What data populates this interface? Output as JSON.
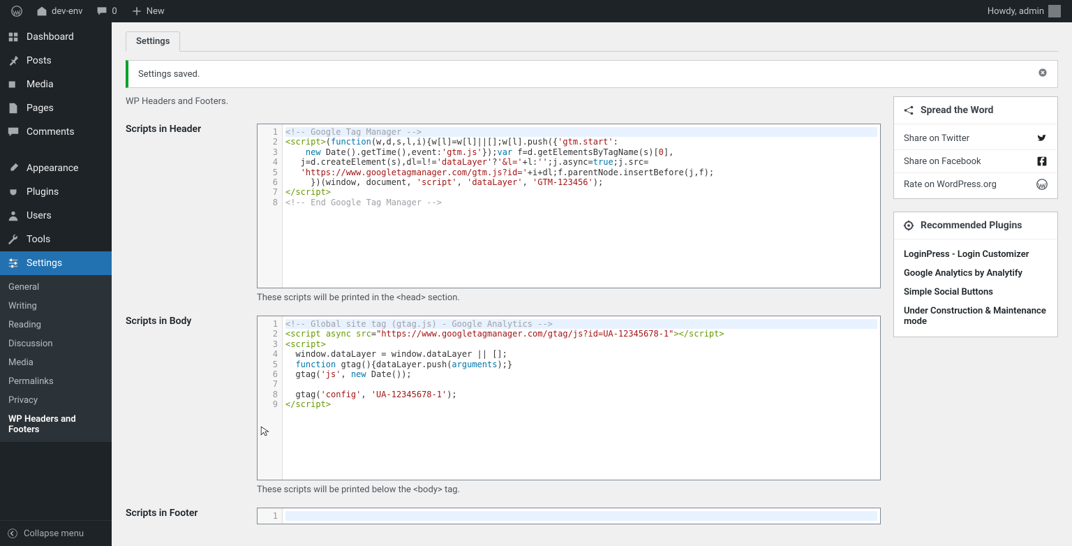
{
  "adminbar": {
    "site": "dev-env",
    "comments": "0",
    "new": "New",
    "howdy": "Howdy, admin"
  },
  "sidebar": {
    "items": [
      {
        "icon": "dashboard",
        "label": "Dashboard"
      },
      {
        "icon": "pin",
        "label": "Posts"
      },
      {
        "icon": "media",
        "label": "Media"
      },
      {
        "icon": "page",
        "label": "Pages"
      },
      {
        "icon": "comment",
        "label": "Comments"
      },
      {
        "icon": "brush",
        "label": "Appearance"
      },
      {
        "icon": "plug",
        "label": "Plugins"
      },
      {
        "icon": "user",
        "label": "Users"
      },
      {
        "icon": "wrench",
        "label": "Tools"
      },
      {
        "icon": "sliders",
        "label": "Settings"
      }
    ],
    "sub": [
      "General",
      "Writing",
      "Reading",
      "Discussion",
      "Media",
      "Permalinks",
      "Privacy",
      "WP Headers and Footers"
    ],
    "collapse": "Collapse menu"
  },
  "page": {
    "tab": "Settings",
    "saved": "Settings saved.",
    "heading": "WP Headers and Footers.",
    "sections": {
      "header": {
        "label": "Scripts in Header",
        "help": "These scripts will be printed in the <head> section."
      },
      "body": {
        "label": "Scripts in Body",
        "help": "These scripts will be printed below the <body> tag."
      },
      "footer": {
        "label": "Scripts in Footer"
      }
    }
  },
  "editors": {
    "header": {
      "lines": 8,
      "code": [
        {
          "t": "comment",
          "v": "<!-- Google Tag Manager -->"
        },
        {
          "raw": "<span class='tag'>&lt;script&gt;</span>(<span class='kw'>function</span>(w,d,s,l,i){w[l]=w[l]||[];w[l].push({<span class='str'>'gtm.start'</span>:"
        },
        {
          "raw": "    <span class='kw'>new</span> Date().getTime(),event:<span class='str'>'gtm.js'</span>});<span class='kw'>var</span> f=d.getElementsByTagName(s)[<span class='str'>0</span>],"
        },
        {
          "raw": "   j=d.createElement(s),dl=l!=<span class='str'>'dataLayer'</span>?<span class='str'>'&amp;l='</span>+l:<span class='str'>''</span>;j.async=<span class='kw'>true</span>;j.src="
        },
        {
          "raw": "   <span class='str'>'https://www.googletagmanager.com/gtm.js?id='</span>+i+dl;f.parentNode.insertBefore(j,f);"
        },
        {
          "raw": "     })(window, document, <span class='str'>'script'</span>, <span class='str'>'dataLayer'</span>, <span class='str'>'GTM-123456'</span>);"
        },
        {
          "raw": "<span class='tag'>&lt;/script&gt;</span>"
        },
        {
          "t": "comment",
          "v": "<!-- End Google Tag Manager -->"
        }
      ]
    },
    "body": {
      "lines": 9,
      "code": [
        {
          "t": "comment",
          "v": "<!-- Global site tag (gtag.js) - Google Analytics -->"
        },
        {
          "raw": "<span class='tag'>&lt;script</span> <span class='attr'>async</span> <span class='attr'>src</span>=<span class='str'>\"https://www.googletagmanager.com/gtag/js?id=UA-12345678-1\"</span><span class='tag'>&gt;&lt;/script&gt;</span>"
        },
        {
          "raw": "<span class='tag'>&lt;script&gt;</span>"
        },
        {
          "raw": "  window.dataLayer = window.dataLayer || [];"
        },
        {
          "raw": "  <span class='kw'>function</span> gtag(){dataLayer.push(<span class='kw'>arguments</span>);}"
        },
        {
          "raw": "  gtag(<span class='str'>'js'</span>, <span class='kw'>new</span> Date());"
        },
        {
          "raw": ""
        },
        {
          "raw": "  gtag(<span class='str'>'config'</span>, <span class='str'>'UA-12345678-1'</span>);"
        },
        {
          "raw": "<span class='tag'>&lt;/script&gt;</span>"
        }
      ]
    },
    "footer": {
      "lines": 1
    }
  },
  "spread": {
    "title": "Spread the Word",
    "items": [
      {
        "label": "Share on Twitter",
        "icon": "twitter"
      },
      {
        "label": "Share on Facebook",
        "icon": "facebook"
      },
      {
        "label": "Rate on WordPress.org",
        "icon": "wordpress"
      }
    ]
  },
  "recommended": {
    "title": "Recommended Plugins",
    "items": [
      "LoginPress - Login Customizer",
      "Google Analytics by Analytify",
      "Simple Social Buttons",
      "Under Construction & Maintenance mode"
    ]
  }
}
